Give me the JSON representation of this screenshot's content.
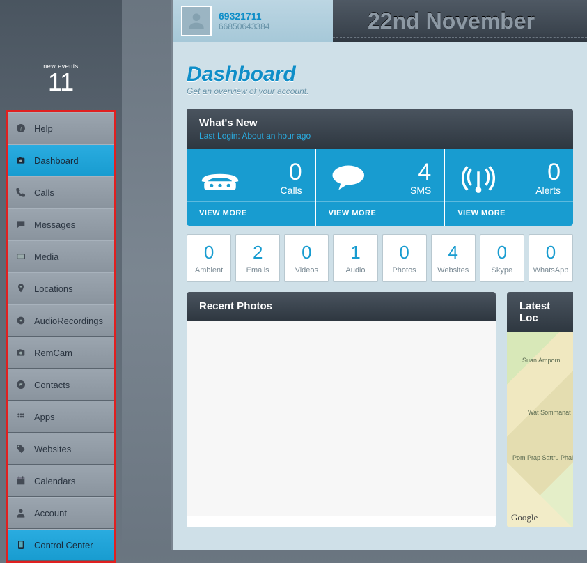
{
  "events": {
    "label": "new events",
    "count": "11"
  },
  "nav": [
    {
      "label": "Help",
      "icon": "info",
      "active": false
    },
    {
      "label": "Dashboard",
      "icon": "camera",
      "active": true
    },
    {
      "label": "Calls",
      "icon": "phone",
      "active": false
    },
    {
      "label": "Messages",
      "icon": "message",
      "active": false
    },
    {
      "label": "Media",
      "icon": "media",
      "active": false
    },
    {
      "label": "Locations",
      "icon": "pin",
      "active": false
    },
    {
      "label": "AudioRecordings",
      "icon": "disc",
      "active": false
    },
    {
      "label": "RemCam",
      "icon": "camera",
      "active": false
    },
    {
      "label": "Contacts",
      "icon": "contacts",
      "active": false
    },
    {
      "label": "Apps",
      "icon": "apps",
      "active": false
    },
    {
      "label": "Websites",
      "icon": "tag",
      "active": false
    },
    {
      "label": "Calendars",
      "icon": "calendar",
      "active": false
    },
    {
      "label": "Account",
      "icon": "person",
      "active": false
    },
    {
      "label": "Control Center",
      "icon": "device",
      "active": true
    }
  ],
  "user": {
    "id": "69321711",
    "sub": "66850643384"
  },
  "date": "22nd November",
  "hero": {
    "title": "Dashboard",
    "tagline": "Get an overview of your account."
  },
  "whatsnew": {
    "title": "What's New",
    "lastlogin": "Last Login: About an hour ago",
    "viewmore": "VIEW MORE"
  },
  "big": [
    {
      "num": "0",
      "label": "Calls",
      "icon": "phone-big"
    },
    {
      "num": "4",
      "label": "SMS",
      "icon": "bubble"
    },
    {
      "num": "0",
      "label": "Alerts",
      "icon": "antenna"
    }
  ],
  "small": [
    {
      "num": "0",
      "label": "Ambient"
    },
    {
      "num": "2",
      "label": "Emails"
    },
    {
      "num": "0",
      "label": "Videos"
    },
    {
      "num": "1",
      "label": "Audio"
    },
    {
      "num": "0",
      "label": "Photos"
    },
    {
      "num": "4",
      "label": "Websites"
    },
    {
      "num": "0",
      "label": "Skype"
    },
    {
      "num": "0",
      "label": "WhatsApp"
    }
  ],
  "panels": {
    "recent_photos": "Recent Photos",
    "latest_loc": "Latest Loc"
  },
  "map": {
    "places": [
      "Suan Amporn",
      "Wat Sommanat",
      "Pom Prap Sattru Phai"
    ],
    "attrib": "Google"
  }
}
